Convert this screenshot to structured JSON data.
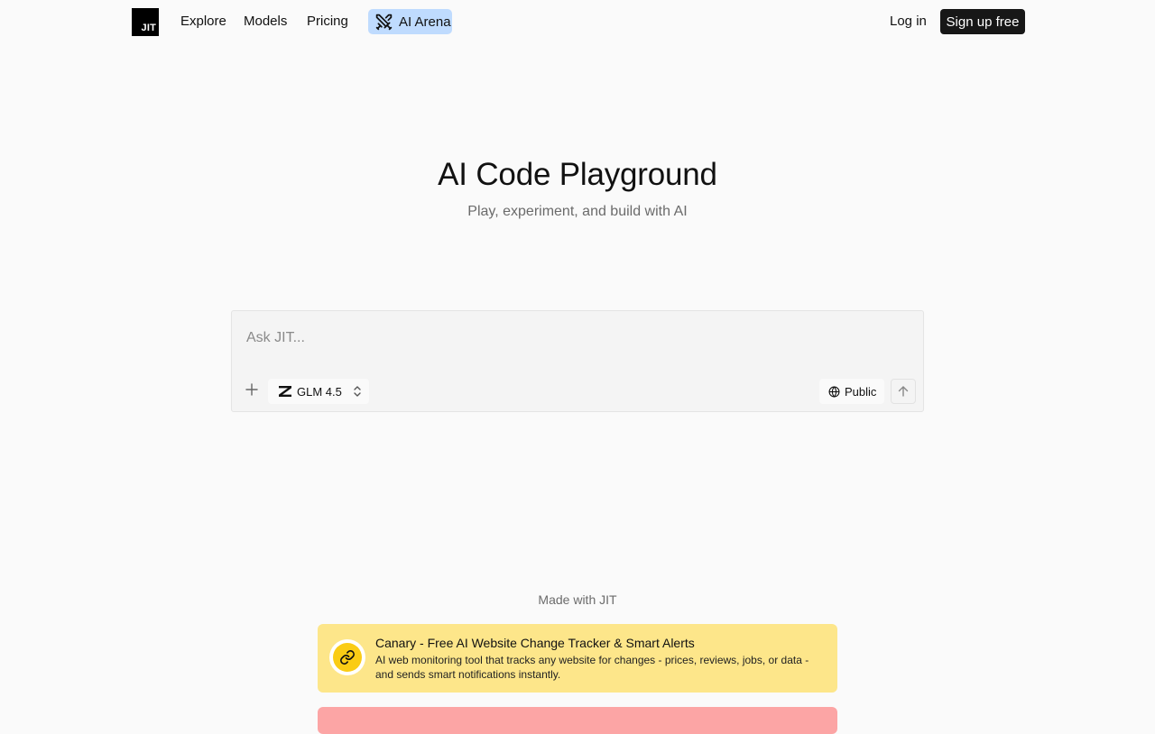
{
  "nav": {
    "logo_text": "JIT",
    "links": [
      "Explore",
      "Models",
      "Pricing"
    ],
    "arena_label": "AI Arena",
    "login_label": "Log in",
    "signup_label": "Sign up free"
  },
  "hero": {
    "title": "AI Code Playground",
    "subtitle": "Play, experiment, and build with AI"
  },
  "prompt": {
    "placeholder": "Ask JIT...",
    "model_label": "GLM 4.5",
    "visibility_label": "Public"
  },
  "showcase": {
    "heading": "Made with JIT",
    "cards": [
      {
        "title": "Canary - Free AI Website Change Tracker & Smart Alerts",
        "description": "AI web monitoring tool that tracks any website for changes - prices, reviews, jobs, or data - and sends smart notifications instantly.",
        "color": "#fde68a",
        "icon": "link-icon"
      },
      {
        "color": "#fca5a5"
      }
    ]
  },
  "colors": {
    "arena_bg": "#bfdbfe",
    "signup_bg": "#171717",
    "page_bg": "#fafafa"
  }
}
